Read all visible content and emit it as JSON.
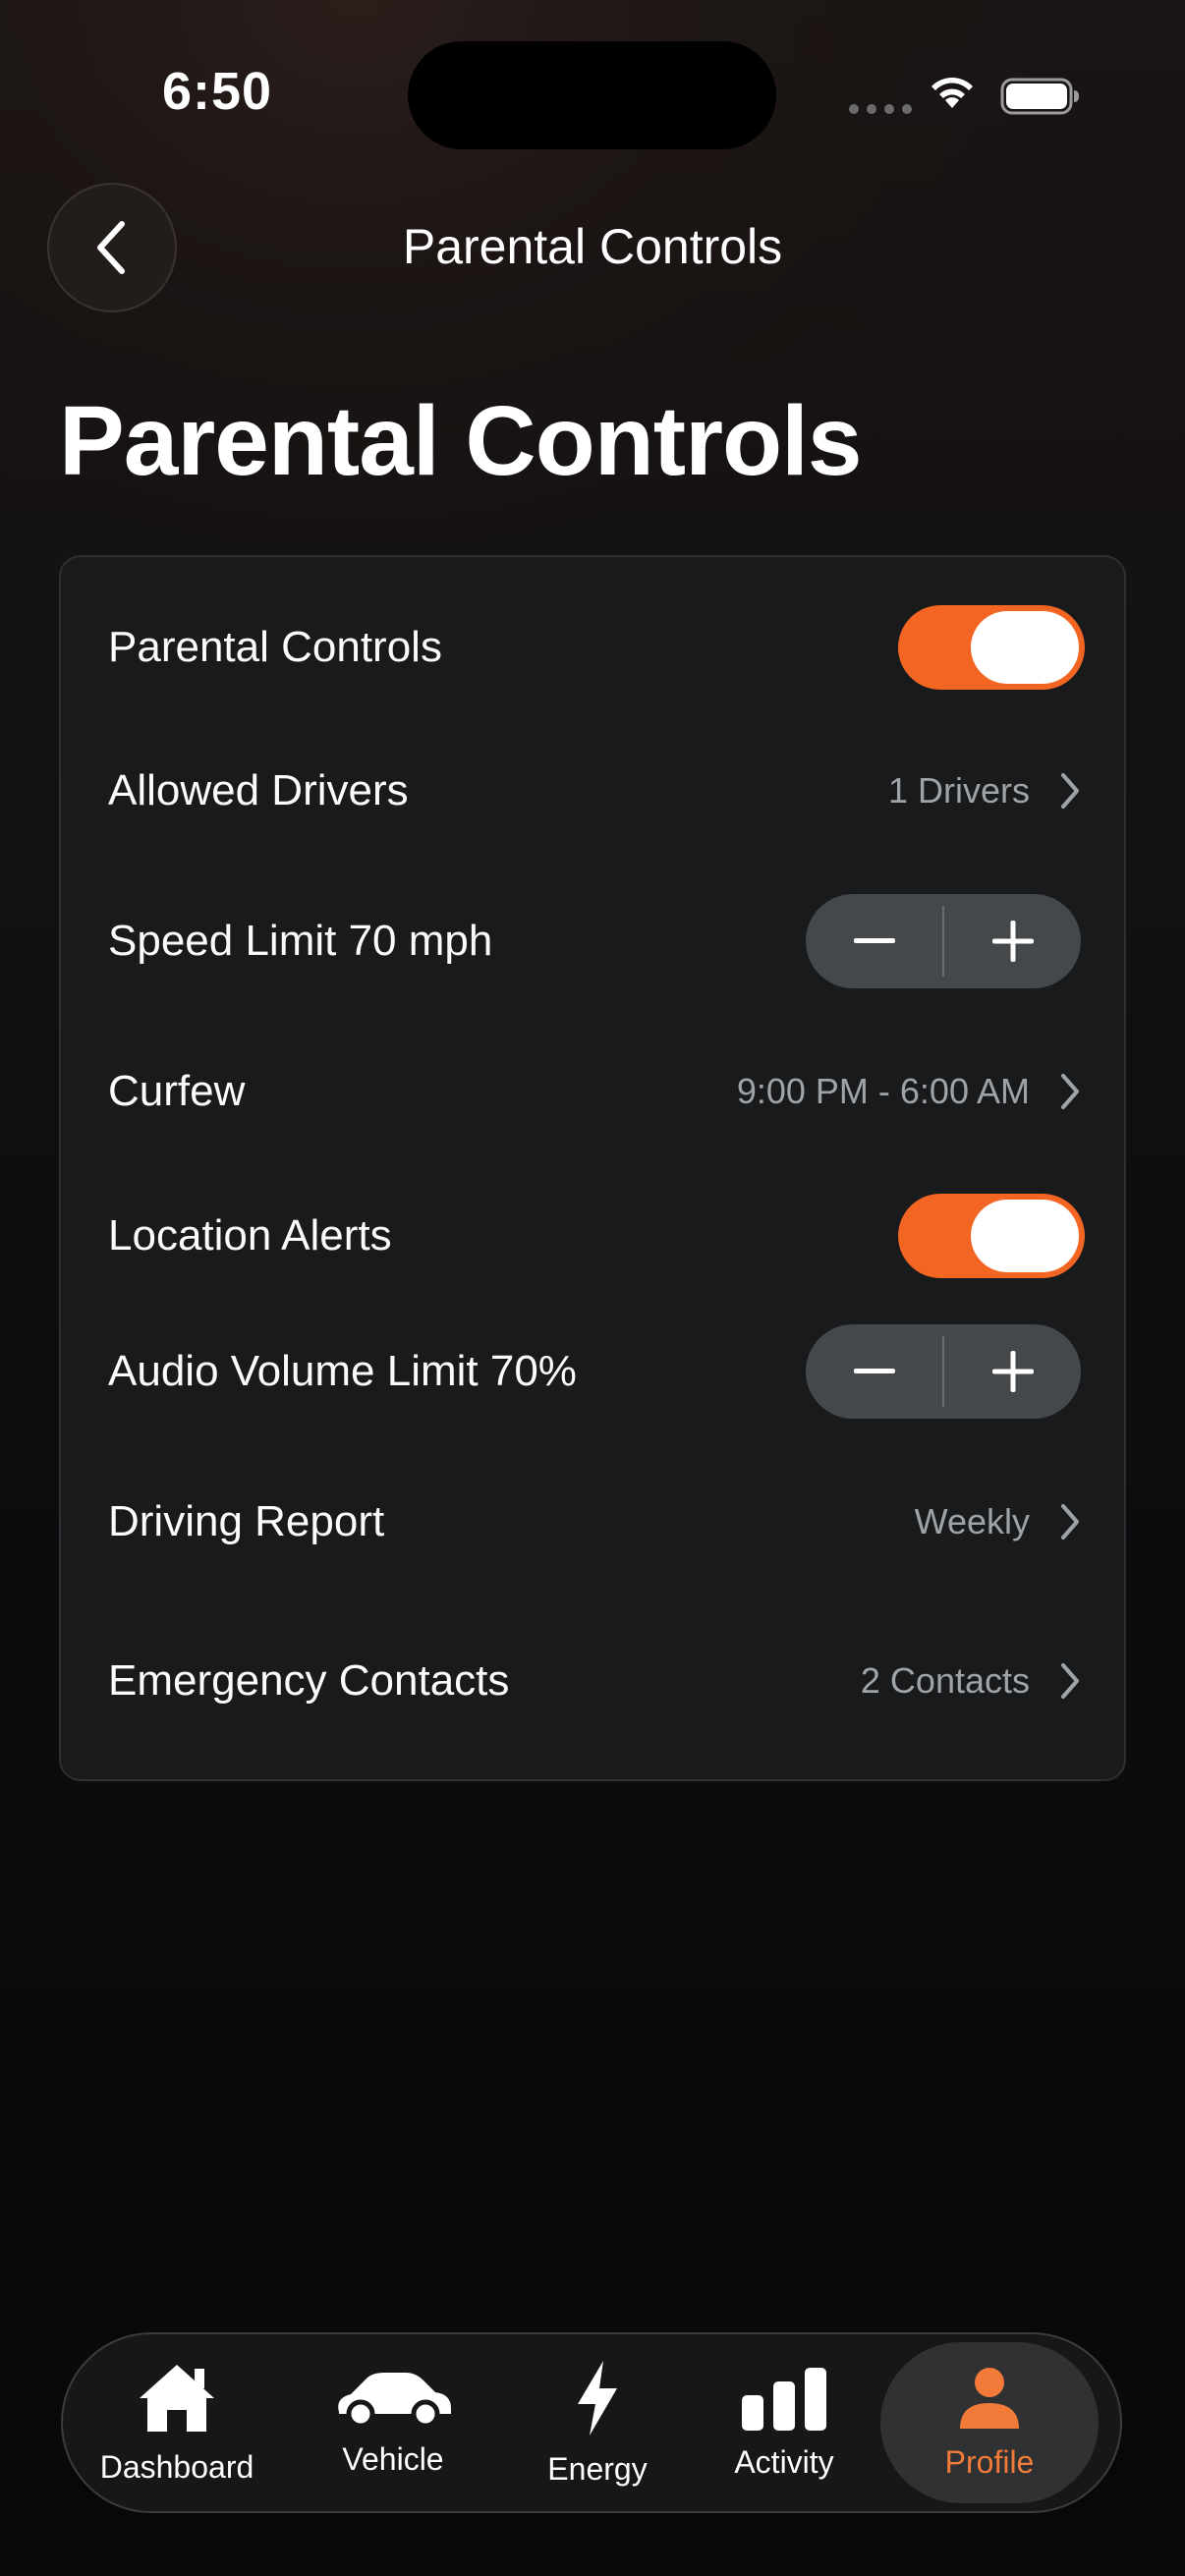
{
  "status_bar": {
    "time": "6:50"
  },
  "header": {
    "nav_title": "Parental Controls",
    "page_title": "Parental Controls"
  },
  "settings": {
    "parental_controls": {
      "label": "Parental Controls",
      "enabled": true
    },
    "allowed_drivers": {
      "label": "Allowed Drivers",
      "value": "1 Drivers"
    },
    "speed_limit": {
      "label": "Speed Limit 70 mph"
    },
    "curfew": {
      "label": "Curfew",
      "value": "9:00 PM - 6:00 AM"
    },
    "location_alerts": {
      "label": "Location Alerts",
      "enabled": true
    },
    "audio_volume_limit": {
      "label": "Audio Volume Limit 70%"
    },
    "driving_report": {
      "label": "Driving Report",
      "value": "Weekly"
    },
    "emergency_contacts": {
      "label": "Emergency Contacts",
      "value": "2 Contacts"
    }
  },
  "tab_bar": {
    "tabs": [
      {
        "label": "Dashboard",
        "icon": "house-icon"
      },
      {
        "label": "Vehicle",
        "icon": "car-icon"
      },
      {
        "label": "Energy",
        "icon": "bolt-icon"
      },
      {
        "label": "Activity",
        "icon": "bar-chart-icon"
      },
      {
        "label": "Profile",
        "icon": "person-icon",
        "active": true
      }
    ]
  },
  "colors": {
    "accent": "#F26522",
    "active_tab": "#F27B3A",
    "card_bg": "#181A1C",
    "secondary_text": "#A0A3A6"
  }
}
